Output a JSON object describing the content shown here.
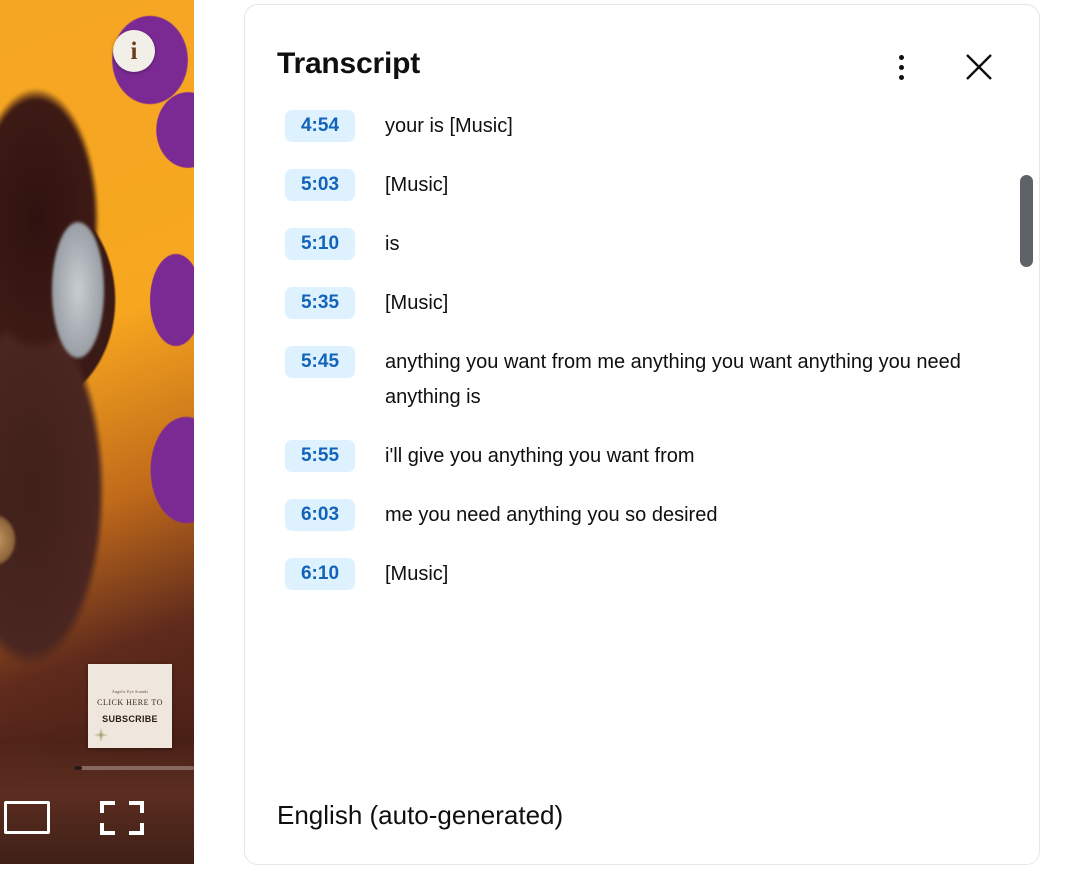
{
  "video": {
    "info_button_label": "i",
    "info_icon": "info-icon",
    "theater_icon": "theater-mode-icon",
    "fullscreen_icon": "fullscreen-icon",
    "subscribe_card": {
      "top_line": "Angelic Eye Sounds",
      "middle_line": "CLICK HERE TO",
      "bottom_line": "SUBSCRIBE"
    }
  },
  "panel": {
    "title": "Transcript",
    "menu_icon": "more-options-icon",
    "close_icon": "close-icon",
    "footer": {
      "language": "English (auto-generated)"
    },
    "entries": [
      {
        "time": "4:54",
        "text": "your is [Music]"
      },
      {
        "time": "5:03",
        "text": "[Music]"
      },
      {
        "time": "5:10",
        "text": "is"
      },
      {
        "time": "5:35",
        "text": "[Music]"
      },
      {
        "time": "5:45",
        "text": "anything you want from me anything you want anything you need anything is"
      },
      {
        "time": "5:55",
        "text": "i'll give you anything you want from"
      },
      {
        "time": "6:03",
        "text": "me you need anything you so desired"
      },
      {
        "time": "6:10",
        "text": "[Music]"
      }
    ]
  },
  "colors": {
    "timestamp_bg": "#def1fe",
    "timestamp_text": "#1263ba",
    "body_text": "#0f0f0f",
    "panel_border": "#e6e6e6",
    "scrollbar_thumb": "#5f6368"
  }
}
